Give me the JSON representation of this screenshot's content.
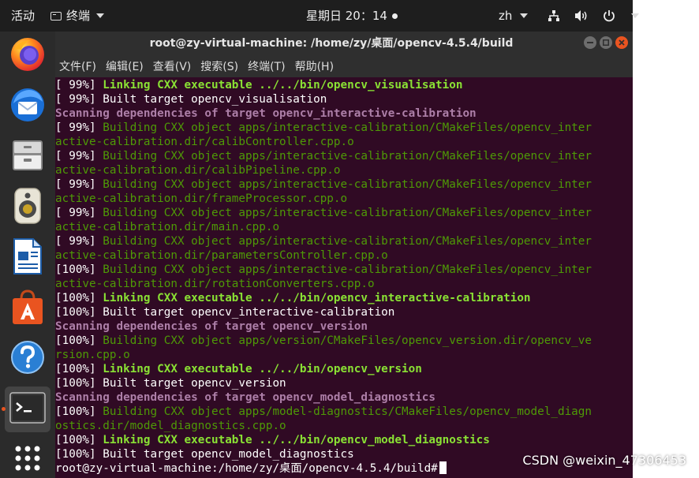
{
  "topbar": {
    "activities": "活动",
    "app_menu_label": "终端",
    "clock": "星期日 20：14",
    "input_method": "zh"
  },
  "dock": {
    "items": [
      {
        "name": "firefox",
        "icon": "firefox-icon"
      },
      {
        "name": "thunderbird",
        "icon": "thunderbird-icon"
      },
      {
        "name": "files",
        "icon": "files-icon"
      },
      {
        "name": "rhythmbox",
        "icon": "speaker-icon"
      },
      {
        "name": "writer",
        "icon": "document-icon"
      },
      {
        "name": "software",
        "icon": "shopping-bag-icon"
      },
      {
        "name": "help",
        "icon": "help-icon"
      },
      {
        "name": "terminal",
        "icon": "terminal-icon",
        "active": true
      },
      {
        "name": "show-apps",
        "icon": "app-grid-icon"
      }
    ]
  },
  "window": {
    "title": "root@zy-virtual-machine: /home/zy/桌面/opencv-4.5.4/build",
    "menu": [
      "文件(F)",
      "编辑(E)",
      "查看(V)",
      "搜索(S)",
      "终端(T)",
      "帮助(H)"
    ]
  },
  "console": {
    "lines": [
      {
        "type": "link",
        "prefix": "[ 99%] ",
        "text": "Linking CXX executable ../../bin/opencv_visualisation"
      },
      {
        "type": "target",
        "prefix": "[ 99%] ",
        "text": "Built target opencv_visualisation"
      },
      {
        "type": "scan",
        "prefix": "",
        "text": "Scanning dependencies of target opencv_interactive-calibration"
      },
      {
        "type": "build",
        "prefix": "[ 99%] ",
        "text": "Building CXX object apps/interactive-calibration/CMakeFiles/opencv_inter"
      },
      {
        "type": "build",
        "prefix": "",
        "text": "active-calibration.dir/calibController.cpp.o"
      },
      {
        "type": "build",
        "prefix": "[ 99%] ",
        "text": "Building CXX object apps/interactive-calibration/CMakeFiles/opencv_inter"
      },
      {
        "type": "build",
        "prefix": "",
        "text": "active-calibration.dir/calibPipeline.cpp.o"
      },
      {
        "type": "build",
        "prefix": "[ 99%] ",
        "text": "Building CXX object apps/interactive-calibration/CMakeFiles/opencv_inter"
      },
      {
        "type": "build",
        "prefix": "",
        "text": "active-calibration.dir/frameProcessor.cpp.o"
      },
      {
        "type": "build",
        "prefix": "[ 99%] ",
        "text": "Building CXX object apps/interactive-calibration/CMakeFiles/opencv_inter"
      },
      {
        "type": "build",
        "prefix": "",
        "text": "active-calibration.dir/main.cpp.o"
      },
      {
        "type": "build",
        "prefix": "[ 99%] ",
        "text": "Building CXX object apps/interactive-calibration/CMakeFiles/opencv_inter"
      },
      {
        "type": "build",
        "prefix": "",
        "text": "active-calibration.dir/parametersController.cpp.o"
      },
      {
        "type": "build",
        "prefix": "[100%] ",
        "text": "Building CXX object apps/interactive-calibration/CMakeFiles/opencv_inter"
      },
      {
        "type": "build",
        "prefix": "",
        "text": "active-calibration.dir/rotationConverters.cpp.o"
      },
      {
        "type": "link",
        "prefix": "[100%] ",
        "text": "Linking CXX executable ../../bin/opencv_interactive-calibration"
      },
      {
        "type": "target",
        "prefix": "[100%] ",
        "text": "Built target opencv_interactive-calibration"
      },
      {
        "type": "scan",
        "prefix": "",
        "text": "Scanning dependencies of target opencv_version"
      },
      {
        "type": "build",
        "prefix": "[100%] ",
        "text": "Building CXX object apps/version/CMakeFiles/opencv_version.dir/opencv_ve"
      },
      {
        "type": "build",
        "prefix": "",
        "text": "rsion.cpp.o"
      },
      {
        "type": "link",
        "prefix": "[100%] ",
        "text": "Linking CXX executable ../../bin/opencv_version"
      },
      {
        "type": "target",
        "prefix": "[100%] ",
        "text": "Built target opencv_version"
      },
      {
        "type": "scan",
        "prefix": "",
        "text": "Scanning dependencies of target opencv_model_diagnostics"
      },
      {
        "type": "build",
        "prefix": "[100%] ",
        "text": "Building CXX object apps/model-diagnostics/CMakeFiles/opencv_model_diagn"
      },
      {
        "type": "build",
        "prefix": "",
        "text": "ostics.dir/model_diagnostics.cpp.o"
      },
      {
        "type": "link",
        "prefix": "[100%] ",
        "text": "Linking CXX executable ../../bin/opencv_model_diagnostics"
      },
      {
        "type": "target",
        "prefix": "[100%] ",
        "text": "Built target opencv_model_diagnostics"
      }
    ],
    "prompt": "root@zy-virtual-machine:/home/zy/桌面/opencv-4.5.4/build#"
  },
  "watermark": "CSDN @weixin_47306453",
  "colors": {
    "terminal_bg": "#300a24",
    "link_green": "#8ae234",
    "build_green": "#4e9a06",
    "scan_purple": "#ad7fa8",
    "ubuntu_orange": "#e95420"
  }
}
